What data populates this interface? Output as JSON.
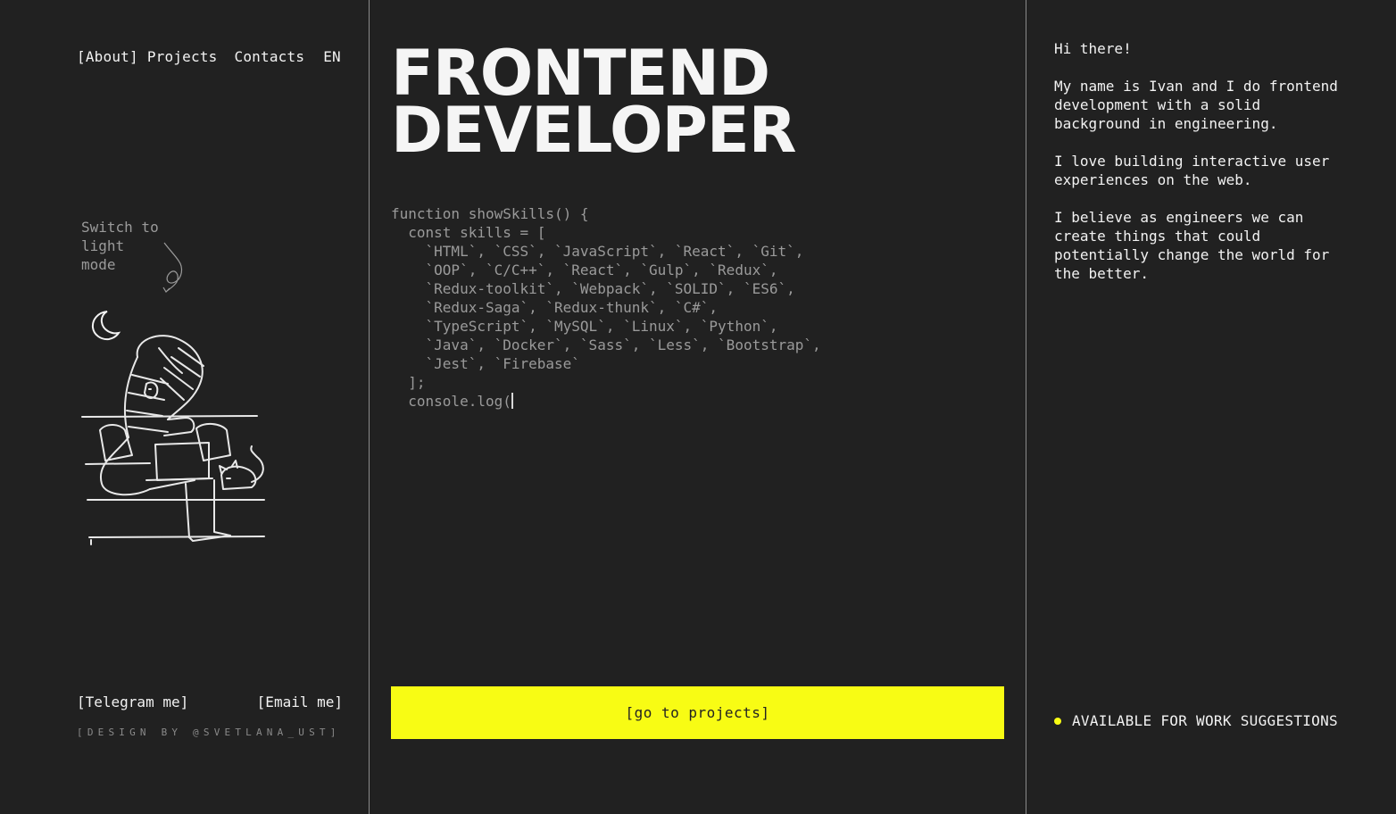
{
  "nav": {
    "about": "[About]",
    "projects": "Projects",
    "contacts": "Contacts",
    "lang": "EN"
  },
  "theme": {
    "switch_label": "Switch to\nlight\nmode",
    "icon": "moon-icon"
  },
  "headline": {
    "line1": "FRONTEND",
    "line2": "DEVELOPER"
  },
  "code_lines": [
    "function showSkills() {",
    "  const skills = [",
    "    `HTML`, `CSS`, `JavaScript`, `React`, `Git`,",
    "    `OOP`, `C/C++`, `React`, `Gulp`, `Redux`,",
    "    `Redux-toolkit`, `Webpack`, `SOLID`, `ES6`,",
    "    `Redux-Saga`, `Redux-thunk`, `C#`,",
    "    `TypeScript`, `MySQL`, `Linux`, `Python`,",
    "    `Java`, `Docker`, `Sass`, `Less`, `Bootstrap`,",
    "    `Jest`, `Firebase`",
    "  ];",
    "  console.log("
  ],
  "cta": {
    "label": "[go to projects]"
  },
  "contacts": {
    "telegram": "[Telegram me]",
    "email": "[Email me]",
    "credit": "[DESIGN BY @SVETLANA_UST]"
  },
  "about": {
    "greeting": "Hi there!",
    "p1": "My name is Ivan and I do frontend development with a solid background in engineering.",
    "p2": "I love building interactive user experiences on the web.",
    "p3": "I believe as engineers we can create things that could potentially change the world for the better."
  },
  "status": {
    "label": "AVAILABLE FOR WORK SUGGESTIONS",
    "color": "#f8fc14"
  },
  "colors": {
    "background": "#212121",
    "accent": "#f8fc14",
    "text": "#f2f2f2",
    "muted": "#9a9a9a"
  }
}
